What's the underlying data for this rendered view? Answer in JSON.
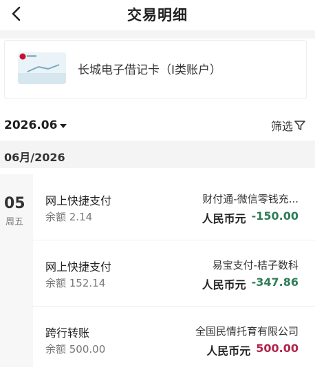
{
  "header": {
    "title": "交易明细"
  },
  "card": {
    "name": "长城电子借记卡（I类账户）"
  },
  "filter": {
    "month": "2026.06",
    "filter_label": "筛选"
  },
  "section": {
    "label": "06月/2026"
  },
  "day": {
    "num": "05",
    "week": "周五"
  },
  "transactions": [
    {
      "type": "网上快捷支付",
      "balance": "余额 2.14",
      "counterparty": "财付通-微信零钱充...",
      "currency": "人民币元",
      "amount": "-150.00",
      "direction": "out"
    },
    {
      "type": "网上快捷支付",
      "balance": "余额 152.14",
      "counterparty": "易宝支付-桔子数科",
      "currency": "人民币元",
      "amount": "-347.86",
      "direction": "out"
    },
    {
      "type": "跨行转账",
      "balance": "余额 500.00",
      "counterparty": "全国民情托育有限公司",
      "currency": "人民币元",
      "amount": "500.00",
      "direction": "in"
    }
  ],
  "colors": {
    "negative": "#2e7d57",
    "positive": "#b2234a"
  },
  "icons": {
    "back": "chevron-left-icon",
    "caret": "caret-down-icon",
    "filter": "filter-funnel-icon",
    "card": "bank-card-icon"
  }
}
